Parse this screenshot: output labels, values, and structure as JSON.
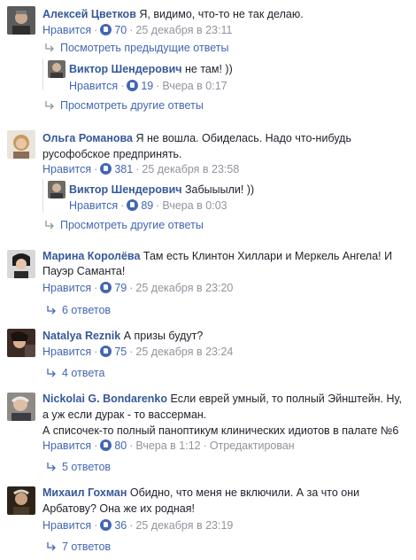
{
  "like_label": "Нравится",
  "comments": [
    {
      "id": "c1",
      "author": "Алексей Цветков",
      "text": [
        "Я, видимо, что-то не так делаю."
      ],
      "likes": "70",
      "time": "25 декабря в 23:11",
      "prev_link": "Посмотреть предыдущие ответы",
      "reply": {
        "author": "Виктор Шендерович",
        "text": "не там! ))",
        "likes": "19",
        "time": "Вчера в 0:17"
      },
      "more_link": "Просмотреть другие ответы"
    },
    {
      "id": "c2",
      "author": "Ольга Романова",
      "text": [
        "Я не вошла. Обиделась. Надо что-нибудь",
        "русофобское предпринять."
      ],
      "likes": "381",
      "time": "25 декабря в 23:58",
      "reply": {
        "author": "Виктор Шендерович",
        "text": "Забыыыли! ))",
        "likes": "89",
        "time": "Вчера в 0:03"
      },
      "more_link": "Просмотреть другие ответы"
    },
    {
      "id": "c3",
      "author": "Марина Королёва",
      "text": [
        "Там есть Клинтон Хиллари и Меркель Ангела! И",
        "Пауэр Саманта!"
      ],
      "likes": "79",
      "time": "25 декабря в 23:20",
      "replies_link": "6 ответов"
    },
    {
      "id": "c4",
      "author": "Natalya Reznik",
      "text": [
        "А призы будут?"
      ],
      "likes": "75",
      "time": "25 декабря в 23:24",
      "replies_link": "4 ответа"
    },
    {
      "id": "c5",
      "author": "Nickolai G. Bondarenko",
      "text": [
        "Если еврей умный, то полный Эйнштейн. Ну,",
        "а уж если дурак - то вассерман.",
        "А списочек-то полный паноптикум клинических идиотов в палате №6"
      ],
      "likes": "80",
      "time": "Вчера в 1:12",
      "edited": "Отредактирован",
      "replies_link": "5 ответов"
    },
    {
      "id": "c6",
      "author": "Михаил Гохман",
      "text": [
        "Обидно, что меня не включили. А за что они",
        "Арбатову? Она же их родная!"
      ],
      "likes": "36",
      "time": "25 декабря в 23:19",
      "replies_link": "7 ответов"
    }
  ]
}
